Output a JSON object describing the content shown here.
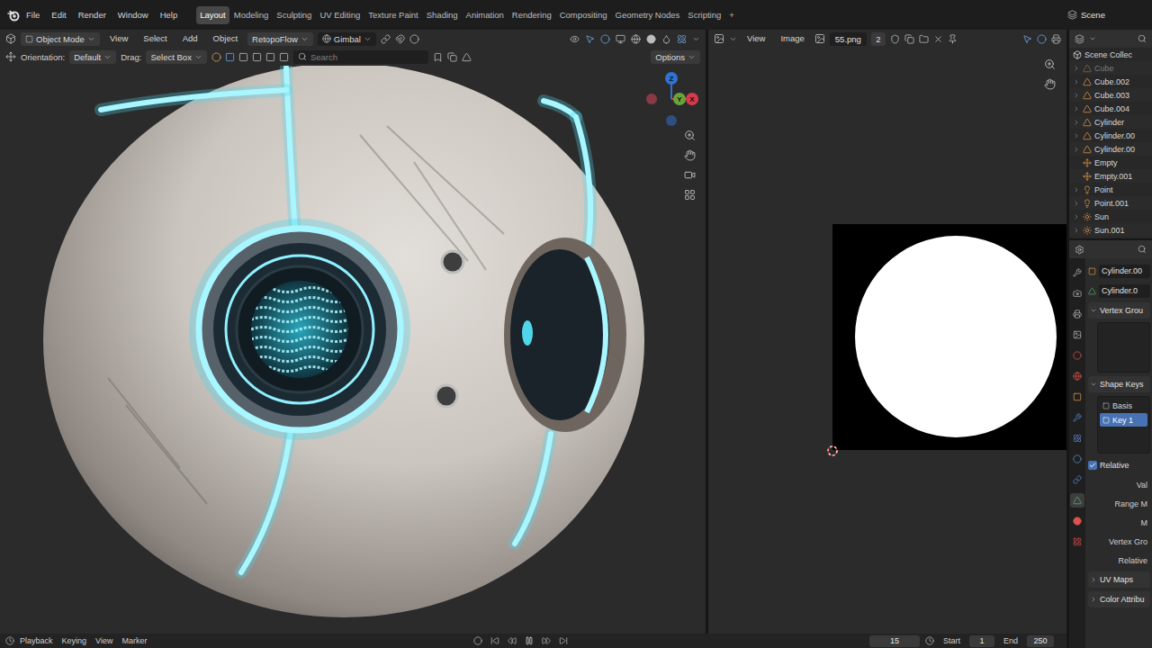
{
  "menu_bar": {
    "menus": [
      "File",
      "Edit",
      "Render",
      "Window",
      "Help"
    ],
    "workspaces": [
      {
        "label": "Layout",
        "selected": true
      },
      {
        "label": "Modeling",
        "selected": false
      },
      {
        "label": "Sculpting",
        "selected": false
      },
      {
        "label": "UV Editing",
        "selected": false
      },
      {
        "label": "Texture Paint",
        "selected": false
      },
      {
        "label": "Shading",
        "selected": false
      },
      {
        "label": "Animation",
        "selected": false
      },
      {
        "label": "Rendering",
        "selected": false
      },
      {
        "label": "Compositing",
        "selected": false
      },
      {
        "label": "Geometry Nodes",
        "selected": false
      },
      {
        "label": "Scripting",
        "selected": false
      }
    ],
    "add_workspace": "+",
    "scene": "Scene"
  },
  "viewport": {
    "mode": "Object Mode",
    "menus": [
      "View",
      "Select",
      "Add",
      "Object"
    ],
    "addon": "RetopoFlow",
    "transform_orientation": "Gimbal",
    "orientation_label": "Orientation:",
    "orientation": "Default",
    "drag_label": "Drag:",
    "drag": "Select Box",
    "search_placeholder": "Search",
    "options": "Options",
    "axes": [
      {
        "label": "Z",
        "color": "#2f72d6"
      },
      {
        "label": "Y",
        "color": "#6aa33a"
      },
      {
        "label": "X",
        "color": "#d43a4c"
      }
    ]
  },
  "image_editor": {
    "menus": [
      "View",
      "Image"
    ],
    "image_name": "55.png",
    "users": "2"
  },
  "outliner": {
    "title": "Scene Collec",
    "items": [
      {
        "label": "Cube",
        "kind": "mesh",
        "hidden": true,
        "expandable": true
      },
      {
        "label": "Cube.002",
        "kind": "mesh",
        "hidden": false,
        "expandable": true
      },
      {
        "label": "Cube.003",
        "kind": "mesh",
        "hidden": false,
        "expandable": true
      },
      {
        "label": "Cube.004",
        "kind": "mesh",
        "hidden": false,
        "expandable": true
      },
      {
        "label": "Cylinder",
        "kind": "mesh",
        "hidden": false,
        "expandable": true
      },
      {
        "label": "Cylinder.00",
        "kind": "mesh",
        "hidden": false,
        "expandable": true
      },
      {
        "label": "Cylinder.00",
        "kind": "mesh",
        "hidden": false,
        "expandable": true
      },
      {
        "label": "Empty",
        "kind": "empty",
        "hidden": false,
        "expandable": false
      },
      {
        "label": "Empty.001",
        "kind": "empty",
        "hidden": false,
        "expandable": false
      },
      {
        "label": "Point",
        "kind": "light",
        "hidden": false,
        "expandable": true
      },
      {
        "label": "Point.001",
        "kind": "light",
        "hidden": false,
        "expandable": true
      },
      {
        "label": "Sun",
        "kind": "sun",
        "hidden": false,
        "expandable": true
      },
      {
        "label": "Sun.001",
        "kind": "sun",
        "hidden": false,
        "expandable": true
      }
    ]
  },
  "properties": {
    "object": "Cylinder.00",
    "mesh": "Cylinder.0",
    "vertex_groups": {
      "title": "Vertex Grou",
      "expanded": true
    },
    "shape_keys": {
      "title": "Shape Keys",
      "expanded": true,
      "keys": [
        {
          "label": "Basis",
          "selected": false
        },
        {
          "label": "Key 1",
          "selected": true
        }
      ],
      "relative": {
        "label": "Relative",
        "checked": true
      },
      "fields": [
        "Val",
        "Range M",
        "M",
        "Vertex Gro",
        "Relative"
      ]
    },
    "sections": [
      {
        "title": "UV Maps",
        "expanded": false
      },
      {
        "title": "Color Attribu",
        "expanded": false
      }
    ]
  },
  "timeline": {
    "menus": [
      "Playback",
      "Keying",
      "View",
      "Marker"
    ],
    "current_frame": "15",
    "start_label": "Start",
    "start": "1",
    "end_label": "End",
    "end": "250"
  }
}
